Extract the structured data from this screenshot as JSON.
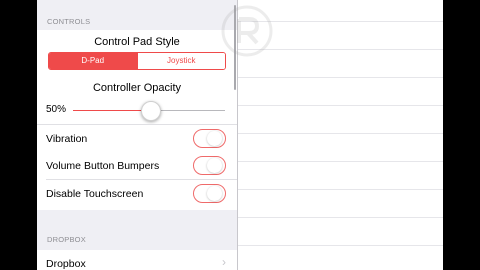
{
  "controls_section": {
    "header": "CONTROLS",
    "control_pad_style": {
      "label": "Control Pad Style",
      "options": [
        "D-Pad",
        "Joystick"
      ],
      "selected": "D-Pad"
    },
    "controller_opacity": {
      "label": "Controller Opacity",
      "value_text": "50%",
      "value": 0.5
    },
    "toggles": [
      {
        "label": "Vibration",
        "on": false
      },
      {
        "label": "Volume Button Bumpers",
        "on": false
      },
      {
        "label": "Disable Touchscreen",
        "on": false
      }
    ]
  },
  "dropbox_section": {
    "header": "DROPBOX",
    "rows": [
      {
        "label": "Dropbox",
        "icon": "chevron-right-icon"
      }
    ]
  },
  "colors": {
    "accent": "#ef4a4a",
    "background": "#efeff4"
  }
}
